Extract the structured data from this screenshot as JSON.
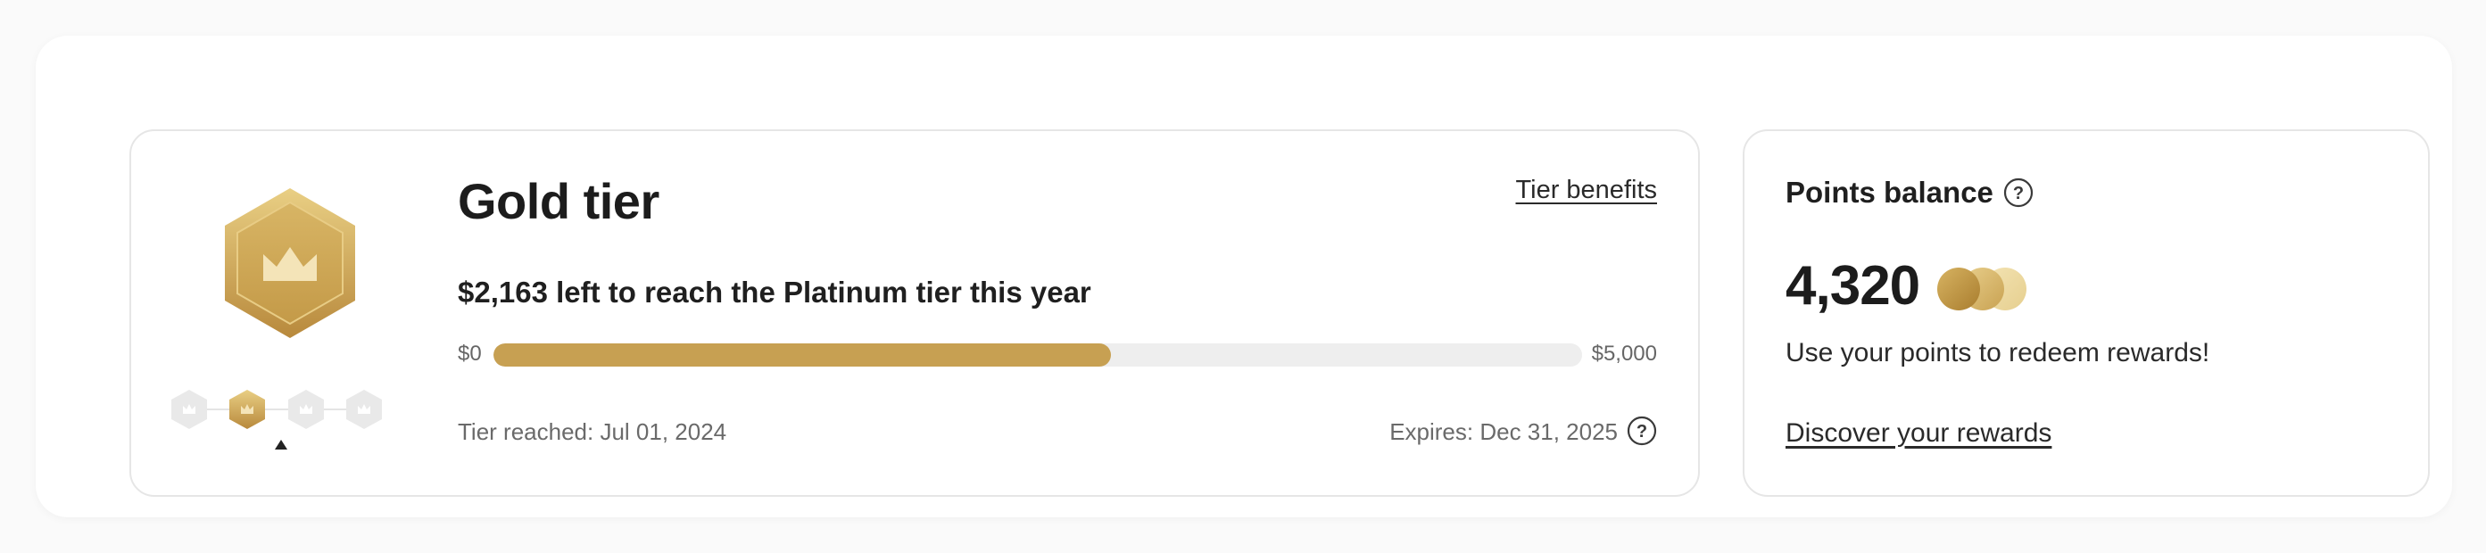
{
  "tier": {
    "title": "Gold tier",
    "benefits_link": "Tier benefits",
    "progress_text": "$2,163 left to reach the Platinum tier this year",
    "range_min": "$0",
    "range_max": "$5,000",
    "progress_fraction": 0.5674,
    "reached": "Tier reached: Jul 01, 2024",
    "expires": "Expires: Dec 31, 2025",
    "current_step": 2,
    "steps": [
      "tier-1",
      "tier-2",
      "tier-3",
      "tier-4"
    ],
    "badge_icon": "crown-icon",
    "accent_color": "#c7a052"
  },
  "points": {
    "title": "Points balance",
    "value": "4,320",
    "description": "Use your points to redeem rewards!",
    "discover_link": "Discover your rewards",
    "coins_icon": "coins-icon"
  }
}
